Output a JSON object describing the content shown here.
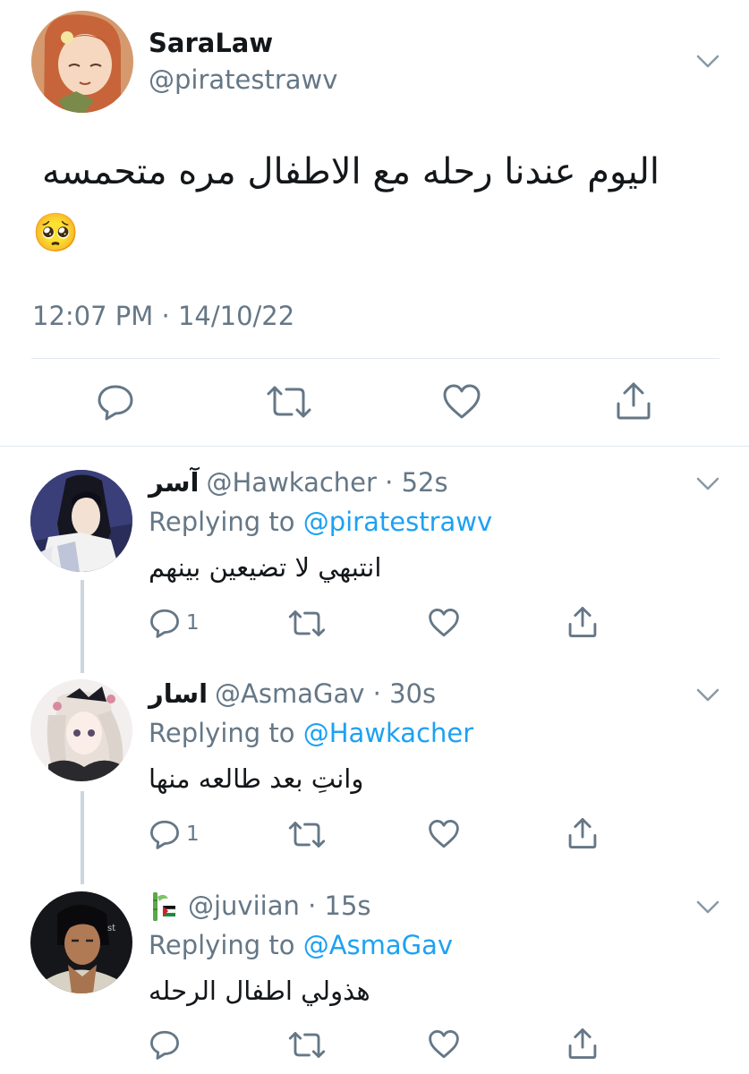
{
  "main_tweet": {
    "display_name": "SaraLaw",
    "handle": "@piratestrawv",
    "text": "اليوم عندنا رحله مع الاطفال مره متحمسه",
    "emoji": "🥺",
    "timestamp": "12:07 PM · 14/10/22"
  },
  "replies": [
    {
      "display_name": "آسر",
      "handle_time": "@Hawkacher · 52s",
      "replying_prefix": "Replying to",
      "replying_to": "@piratestrawv",
      "text": "انتبهي لا تضيعين بينهم",
      "reply_count": "1"
    },
    {
      "display_name": "اسار",
      "handle_time": "@AsmaGav · 30s",
      "replying_prefix": "Replying to",
      "replying_to": "@Hawkacher",
      "text": "وانتِ بعد طالعه منها",
      "reply_count": "1"
    },
    {
      "display_name": "",
      "handle_time": "@juviian · 15s",
      "replying_prefix": "Replying to",
      "replying_to": "@AsmaGav",
      "text": "هذولي اطفال الرحله",
      "reply_count": ""
    }
  ],
  "icons": [
    "reply-icon",
    "retweet-icon",
    "like-icon",
    "share-icon",
    "chevron-down-icon"
  ],
  "colors": {
    "accent": "#1da1f2",
    "secondary_text": "#657786",
    "primary_text": "#14171a",
    "divider": "#e1e8ed"
  }
}
